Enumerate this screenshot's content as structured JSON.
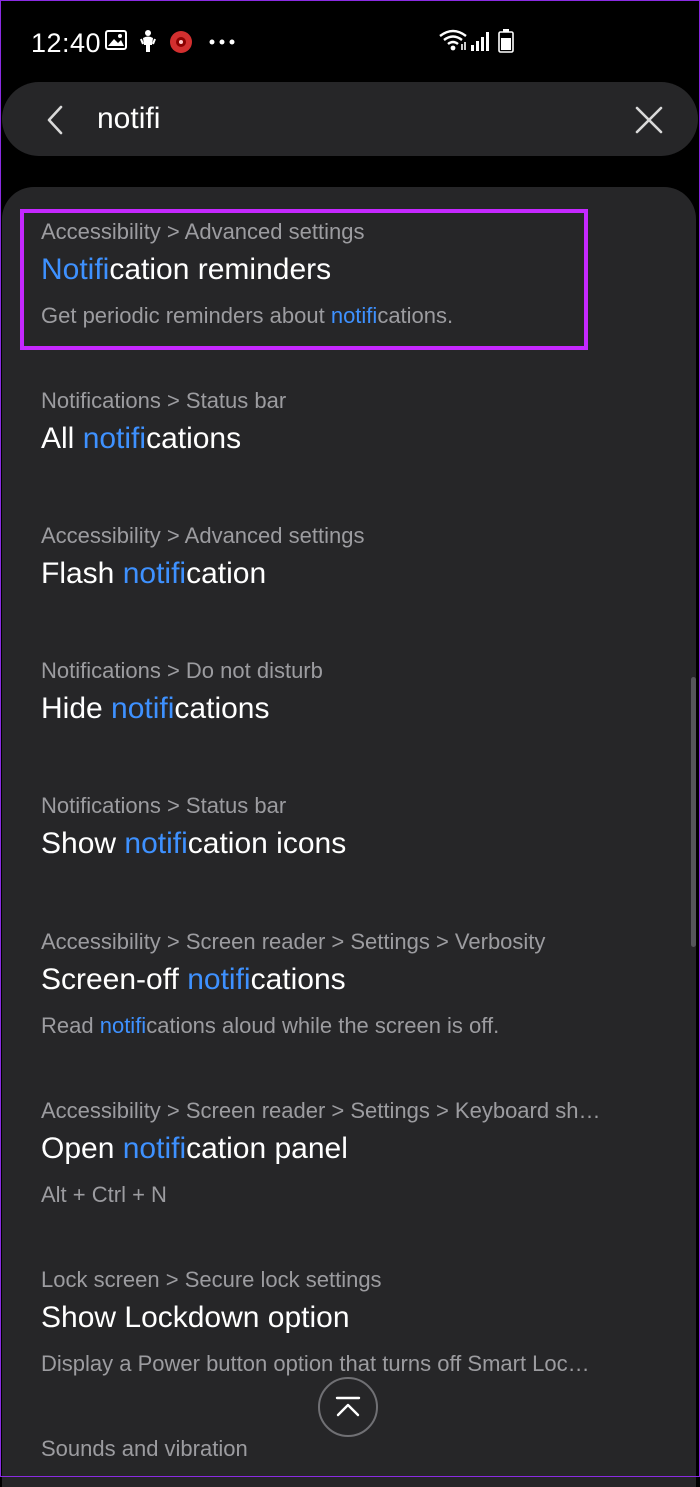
{
  "status_bar": {
    "time": "12:40",
    "icons_left": [
      "gallery-icon",
      "android-icon",
      "app-notification-icon",
      "more-dots-icon"
    ],
    "icons_right": [
      "wifi-icon",
      "cell-signal-icon",
      "battery-icon"
    ]
  },
  "search": {
    "query": "notifi",
    "back_icon": "chevron-left-icon",
    "clear_icon": "close-icon"
  },
  "results": [
    {
      "path": "Accessibility > Advanced settings",
      "title_pre": "",
      "title_hl": "Notifi",
      "title_post": "cation reminders",
      "summary_pre": "Get periodic reminders about ",
      "summary_hl": "notifi",
      "summary_post": "cations."
    },
    {
      "path": "Notifications > Status bar",
      "title_pre": "All ",
      "title_hl": "notifi",
      "title_post": "cations"
    },
    {
      "path": "Accessibility > Advanced settings",
      "title_pre": "Flash ",
      "title_hl": "notifi",
      "title_post": "cation"
    },
    {
      "path": "Notifications > Do not disturb",
      "title_pre": "Hide ",
      "title_hl": "notifi",
      "title_post": "cations"
    },
    {
      "path": "Notifications > Status bar",
      "title_pre": "Show ",
      "title_hl": "notifi",
      "title_post": "cation icons"
    },
    {
      "path": "Accessibility > Screen reader > Settings > Verbosity",
      "title_pre": "Screen-off ",
      "title_hl": "notifi",
      "title_post": "cations",
      "summary_pre": "Read ",
      "summary_hl": "notifi",
      "summary_post": "cations aloud while the screen is off."
    },
    {
      "path": "Accessibility > Screen reader > Settings > Keyboard sh…",
      "title_pre": "Open ",
      "title_hl": "notifi",
      "title_post": "cation panel",
      "summary_pre": "Alt + Ctrl + N",
      "summary_hl": "",
      "summary_post": ""
    },
    {
      "path": "Lock screen > Secure lock settings",
      "title_pre": "Show Lockdown option",
      "title_hl": "",
      "title_post": "",
      "summary_pre": "Display a Power button option that turns off Smart Loc…",
      "summary_hl": "",
      "summary_post": ""
    },
    {
      "path": "Sounds and vibration",
      "title_pre": "",
      "title_hl": "",
      "title_post": ""
    }
  ],
  "scroll_top_icon": "chevron-up-bar-icon",
  "colors": {
    "background": "#000000",
    "surface": "#262628",
    "highlight_text": "#3e91ff",
    "annotation_border": "#c528ff",
    "secondary_text": "#9c9ca0"
  }
}
